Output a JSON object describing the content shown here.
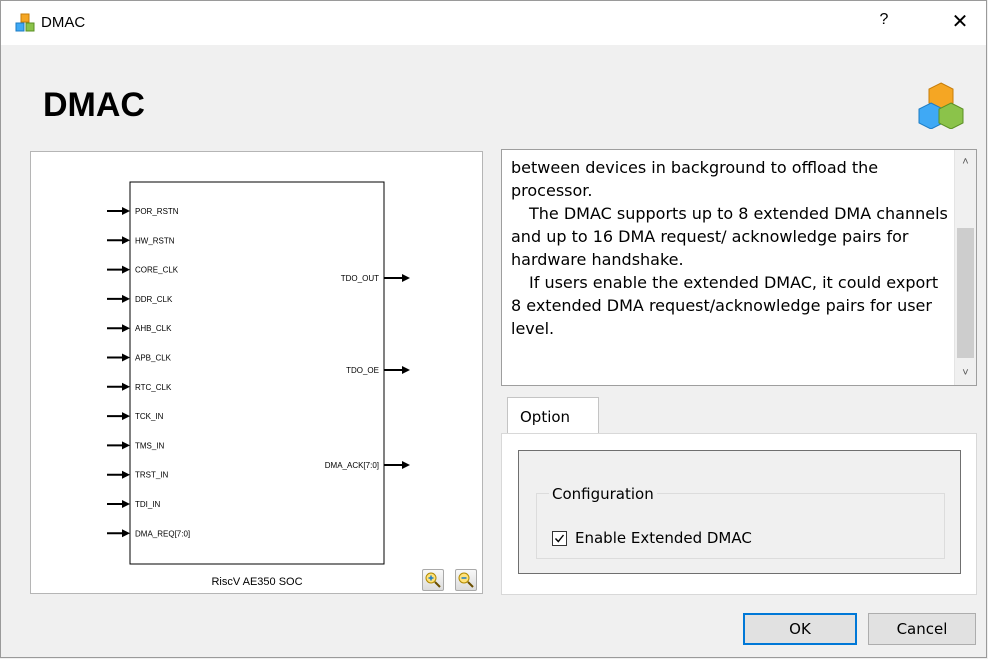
{
  "window": {
    "title": "DMAC",
    "help_label": "?",
    "close_label": "✕"
  },
  "header": {
    "title": "DMAC"
  },
  "diagram": {
    "inputs": [
      "POR_RSTN",
      "HW_RSTN",
      "CORE_CLK",
      "DDR_CLK",
      "AHB_CLK",
      "APB_CLK",
      "RTC_CLK",
      "TCK_IN",
      "TMS_IN",
      "TRST_IN",
      "TDI_IN",
      "DMA_REQ[7:0]"
    ],
    "outputs": [
      "TDO_OUT",
      "TDO_OE",
      "DMA_ACK[7:0]"
    ],
    "caption": "RiscV AE350 SOC",
    "zoom_in_icon": "zoom-in-icon",
    "zoom_out_icon": "zoom-out-icon"
  },
  "description": {
    "lines": [
      "between devices in background to offload the processor.",
      "The DMAC supports up to 8 extended DMA channels and up to 16 DMA request/ acknowledge pairs for hardware handshake.",
      "If users enable the extended DMAC, it could export 8 extended DMA request/acknowledge pairs for user level."
    ]
  },
  "options": {
    "tab_label": "Option",
    "group_title": "Configuration",
    "checkbox_label": "Enable Extended DMAC",
    "checkbox_checked": true
  },
  "buttons": {
    "ok": "OK",
    "cancel": "Cancel"
  },
  "colors": {
    "accent": "#0078d7",
    "icon_orange": "#f5a623",
    "icon_blue": "#3fa9f5",
    "icon_green": "#8bc34a"
  }
}
